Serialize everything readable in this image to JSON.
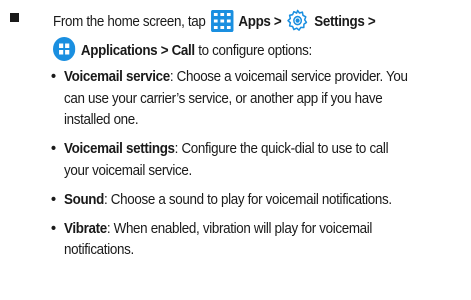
{
  "intro": {
    "prefix": "From the home screen, tap",
    "apps_label": "Apps >",
    "settings_label": "Settings >",
    "applications_call_label": "Applications > Call",
    "suffix": "to configure options:",
    "icons": {
      "apps": "apps-grid-icon",
      "settings": "settings-gear-icon",
      "applications": "applications-icon"
    },
    "icon_color": "#1a8fe0"
  },
  "items": [
    {
      "term": "Voicemail service",
      "desc_lines": [
        ": Choose a voicemail service provider. You",
        "can use your carrier’s service, or another app if you have",
        "installed one."
      ]
    },
    {
      "term": "Voicemail settings",
      "desc_lines": [
        ": Configure the quick-dial to use to call",
        "your voicemail service."
      ]
    },
    {
      "term": "Sound",
      "desc_lines": [
        ": Choose a sound to play for voicemail notifications."
      ]
    },
    {
      "term": "Vibrate",
      "desc_lines": [
        ": When enabled, vibration will play for voicemail",
        "notifications."
      ]
    }
  ]
}
